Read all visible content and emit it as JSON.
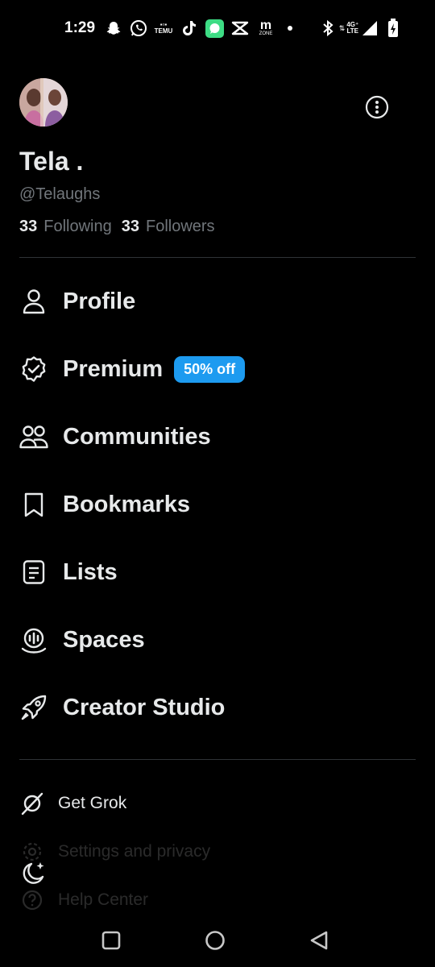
{
  "status_bar": {
    "time": "1:29",
    "icons": [
      "snapchat-icon",
      "whatsapp-icon",
      "temu-icon",
      "tiktok-icon",
      "messages-icon",
      "capcut-icon",
      "mzone-icon",
      "dot-icon",
      "bluetooth-icon",
      "lte-icon",
      "signal-icon",
      "battery-icon"
    ],
    "temu_text": "TEMU",
    "mzone_text": "m",
    "mzone_sub": "ZONE",
    "network_top": "4G⁺",
    "network_bottom": "LTE"
  },
  "profile": {
    "display_name": "Tela .",
    "handle": "@Telaughs",
    "following_count": "33",
    "following_label": "Following",
    "followers_count": "33",
    "followers_label": "Followers"
  },
  "menu": {
    "profile": "Profile",
    "premium": "Premium",
    "premium_badge": "50% off",
    "communities": "Communities",
    "bookmarks": "Bookmarks",
    "lists": "Lists",
    "spaces": "Spaces",
    "creator_studio": "Creator Studio"
  },
  "secondary": {
    "get_grok": "Get Grok",
    "settings": "Settings and privacy",
    "help": "Help Center"
  },
  "colors": {
    "background": "#000000",
    "accent": "#1d9bf0",
    "text_primary": "#e7e9ea",
    "text_secondary": "#71767b",
    "divider": "#2f3336"
  }
}
